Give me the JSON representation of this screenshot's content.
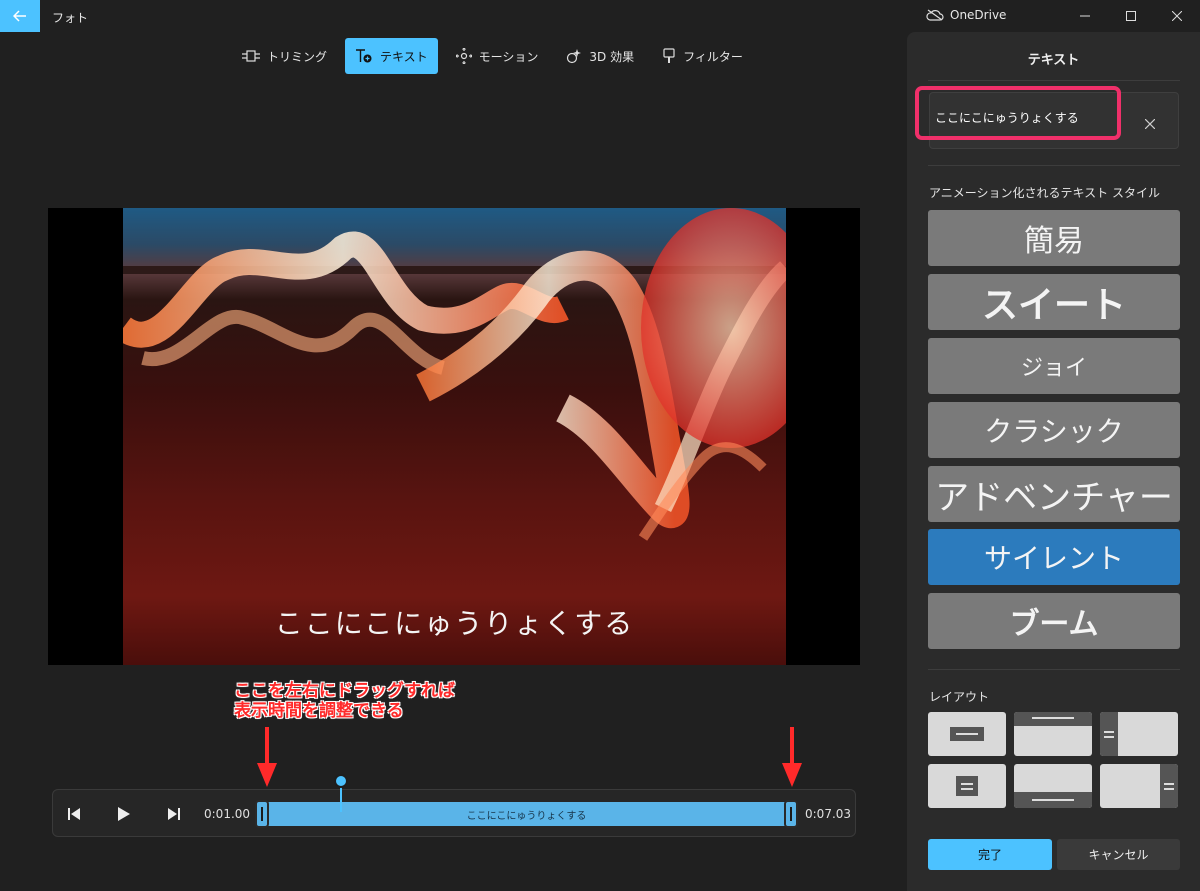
{
  "window": {
    "app_title": "フォト",
    "onedrive_label": "OneDrive",
    "accent_color": "#4cc2ff"
  },
  "toolbar": {
    "items": [
      {
        "label": "トリミング",
        "icon": "trim-icon"
      },
      {
        "label": "テキスト",
        "icon": "text-icon",
        "active": true
      },
      {
        "label": "モーション",
        "icon": "motion-icon"
      },
      {
        "label": "3D 効果",
        "icon": "3d-effects-icon"
      },
      {
        "label": "フィルター",
        "icon": "filter-icon"
      }
    ]
  },
  "preview": {
    "overlay_text": "ここにこにゅうりょくする"
  },
  "annotation": {
    "line1": "ここを左右にドラッグすれば",
    "line2": "表示時間を調整できる",
    "color": "#ff2a2a"
  },
  "timeline": {
    "start_time": "0:01.00",
    "end_time": "0:07.03",
    "track_label": "ここにこにゅうりょくする"
  },
  "panel": {
    "title": "テキスト",
    "text_input_value": "ここにこにゅうりょくする",
    "clear_icon": "close-icon",
    "styles_heading": "アニメーション化されるテキスト スタイル",
    "styles": [
      {
        "label": "簡易"
      },
      {
        "label": "スイート"
      },
      {
        "label": "ジョイ"
      },
      {
        "label": "クラシック"
      },
      {
        "label": "アドベンチャー"
      },
      {
        "label": "サイレント",
        "selected": true
      },
      {
        "label": "ブーム"
      }
    ],
    "layout_heading": "レイアウト",
    "done_label": "完了",
    "cancel_label": "キャンセル",
    "selected_color": "#2c7bbd",
    "highlight_color": "#f0306a"
  }
}
